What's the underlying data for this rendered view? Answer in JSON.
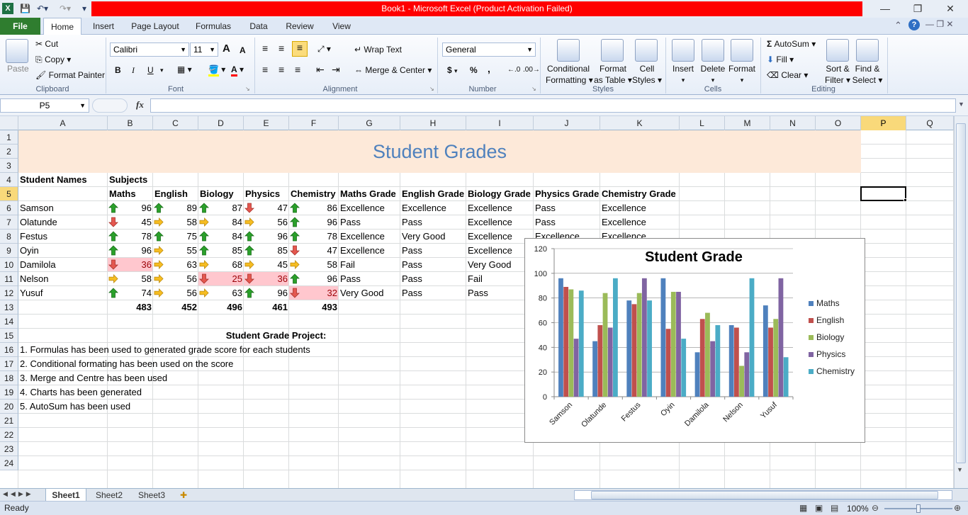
{
  "window": {
    "title": "Book1  -  Microsoft Excel (Product Activation Failed)",
    "colors": {
      "title_band": "#ff0000",
      "file_tab": "#2f7d2f",
      "selection": "#f9d97a"
    }
  },
  "tabs": [
    "File",
    "Home",
    "Insert",
    "Page Layout",
    "Formulas",
    "Data",
    "Review",
    "View"
  ],
  "ribbon": {
    "clipboard": {
      "paste": "Paste",
      "cut": "Cut",
      "copy": "Copy",
      "format_painter": "Format Painter",
      "label": "Clipboard"
    },
    "font": {
      "name": "Calibri",
      "size": "11",
      "label": "Font",
      "bold": "B",
      "italic": "I",
      "underline": "U",
      "grow": "A",
      "shrink": "A"
    },
    "alignment": {
      "wrap": "Wrap Text",
      "merge": "Merge & Center",
      "label": "Alignment"
    },
    "number": {
      "format": "General",
      "currency": "$",
      "percent": "%",
      "comma": ",",
      "label": "Number"
    },
    "styles": {
      "conditional": "Conditional",
      "conditional2": "Formatting",
      "format_table": "Format",
      "format_table2": "as Table",
      "cell_styles": "Cell",
      "cell_styles2": "Styles",
      "label": "Styles"
    },
    "cells": {
      "insert": "Insert",
      "delete": "Delete",
      "format": "Format",
      "label": "Cells"
    },
    "editing": {
      "autosum": "AutoSum",
      "fill": "Fill",
      "clear": "Clear",
      "sort": "Sort &",
      "sort2": "Filter",
      "find": "Find &",
      "find2": "Select",
      "label": "Editing"
    }
  },
  "formula_bar": {
    "name_box": "P5",
    "fx": "fx",
    "value": ""
  },
  "columns": [
    "A",
    "B",
    "C",
    "D",
    "E",
    "F",
    "G",
    "H",
    "I",
    "J",
    "K",
    "L",
    "M",
    "N",
    "O",
    "P",
    "Q"
  ],
  "rows": [
    "1",
    "2",
    "3",
    "4",
    "5",
    "6",
    "7",
    "8",
    "9",
    "10",
    "11",
    "12",
    "13",
    "14",
    "15",
    "16",
    "17",
    "18",
    "19",
    "20",
    "21",
    "22",
    "23",
    "24"
  ],
  "sheet": {
    "title": "Student Grades",
    "header_row4": {
      "a": "Student Names",
      "b": "Subjects"
    },
    "headers": [
      "Maths",
      "English",
      "Biology",
      "Physics",
      "Chemistry",
      "Maths Grade",
      "English Grade",
      "Biology Grade",
      "Physics Grade",
      "Chemistry Grade"
    ],
    "students": [
      {
        "name": "Samson",
        "scores": [
          "96",
          "89",
          "87",
          "47",
          "86"
        ],
        "arrows": [
          "up",
          "up",
          "up",
          "down",
          "up"
        ],
        "grades": [
          "Excellence",
          "Excellence",
          "Excellence",
          "Pass",
          "Excellence"
        ]
      },
      {
        "name": "Olatunde",
        "scores": [
          "45",
          "58",
          "84",
          "56",
          "96"
        ],
        "arrows": [
          "down",
          "right",
          "right",
          "right",
          "up"
        ],
        "grades": [
          "Pass",
          "Pass",
          "Excellence",
          "Pass",
          "Excellence"
        ]
      },
      {
        "name": "Festus",
        "scores": [
          "78",
          "75",
          "84",
          "96",
          "78"
        ],
        "arrows": [
          "up",
          "up",
          "up",
          "up",
          "up"
        ],
        "grades": [
          "Excellence",
          "Very Good",
          "Excellence",
          "Excellence",
          "Excellence"
        ]
      },
      {
        "name": "Oyin",
        "scores": [
          "96",
          "55",
          "85",
          "85",
          "47"
        ],
        "arrows": [
          "up",
          "right",
          "up",
          "up",
          "down"
        ],
        "grades": [
          "Excellence",
          "Pass",
          "Excellence",
          "",
          ""
        ]
      },
      {
        "name": "Damilola",
        "scores": [
          "36",
          "63",
          "68",
          "45",
          "58"
        ],
        "arrows": [
          "down",
          "right",
          "right",
          "right",
          "right"
        ],
        "grades": [
          "Fail",
          "Pass",
          "Very Good",
          "",
          ""
        ]
      },
      {
        "name": "Nelson",
        "scores": [
          "58",
          "56",
          "25",
          "36",
          "96"
        ],
        "arrows": [
          "right",
          "right",
          "down",
          "down",
          "up"
        ],
        "grades": [
          "Pass",
          "Pass",
          "Fail",
          "",
          ""
        ]
      },
      {
        "name": "Yusuf",
        "scores": [
          "74",
          "56",
          "63",
          "96",
          "32"
        ],
        "arrows": [
          "up",
          "right",
          "right",
          "up",
          "down"
        ],
        "grades": [
          "Very Good",
          "Pass",
          "Pass",
          "",
          ""
        ]
      }
    ],
    "totals": [
      "483",
      "452",
      "496",
      "461",
      "493"
    ],
    "project_title": "Student Grade Project:",
    "notes": [
      "1. Formulas has been used to generated grade score for each students",
      "2. Conditional formating has been used  on the score",
      "3. Merge and Centre has been used",
      "4. Charts has been generated",
      "5. AutoSum has been used"
    ]
  },
  "chart_data": {
    "type": "bar",
    "title": "Student Grade",
    "categories": [
      "Samson",
      "Olatunde",
      "Festus",
      "Oyin",
      "Damilola",
      "Nelson",
      "Yusuf"
    ],
    "series": [
      {
        "name": "Maths",
        "values": [
          96,
          45,
          78,
          96,
          36,
          58,
          74
        ],
        "color": "#4f81bd"
      },
      {
        "name": "English",
        "values": [
          89,
          58,
          75,
          55,
          63,
          56,
          56
        ],
        "color": "#c0504d"
      },
      {
        "name": "Biology",
        "values": [
          87,
          84,
          84,
          85,
          68,
          25,
          63
        ],
        "color": "#9bbb59"
      },
      {
        "name": "Physics",
        "values": [
          47,
          56,
          96,
          85,
          45,
          36,
          96
        ],
        "color": "#8064a2"
      },
      {
        "name": "Chemistry",
        "values": [
          86,
          96,
          78,
          47,
          58,
          96,
          32
        ],
        "color": "#4bacc6"
      }
    ],
    "ylim": [
      0,
      120
    ],
    "yticks": [
      "0",
      "20",
      "40",
      "60",
      "80",
      "100",
      "120"
    ],
    "grid": true,
    "legend": "right"
  },
  "sheets": [
    "Sheet1",
    "Sheet2",
    "Sheet3"
  ],
  "status": {
    "ready": "Ready",
    "zoom": "100%"
  }
}
